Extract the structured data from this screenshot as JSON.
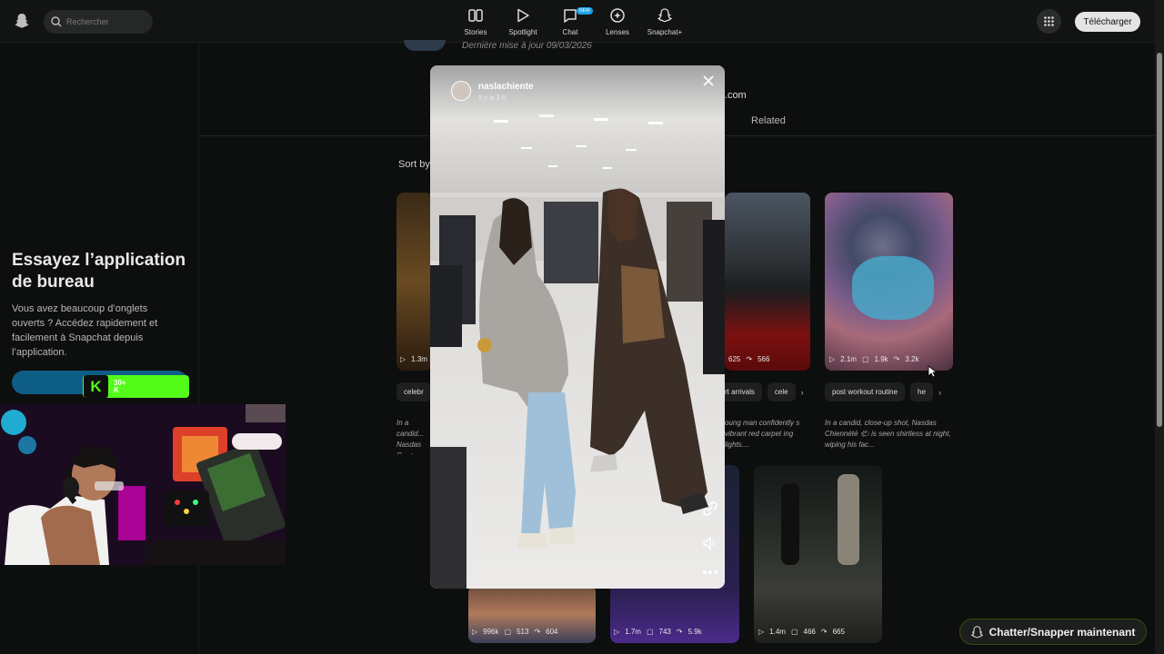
{
  "topbar": {
    "search_placeholder": "Rechercher",
    "nav": [
      {
        "label": "Stories",
        "icon": "stories-icon"
      },
      {
        "label": "Spotlight",
        "icon": "play-icon"
      },
      {
        "label": "Chat",
        "icon": "chat-icon",
        "badge": "NEW"
      },
      {
        "label": "Lenses",
        "icon": "lenses-icon"
      },
      {
        "label": "Snapchat+",
        "icon": "snapchat-plus-icon"
      }
    ],
    "download_label": "Télécharger"
  },
  "sidebar": {
    "promo_title": "Essayez l’application de bureau",
    "promo_text": "Vous avez beaucoup d’onglets ouverts ? Accédez rapidement et facilement à Snapchat depuis l’application."
  },
  "profile": {
    "updated": "Dernière mise à jour 09/03/2026",
    "email_fragment": "il.com",
    "tab_related": "Related",
    "sort_by": "Sort by"
  },
  "cards": [
    {
      "stats": [
        "1.3m"
      ],
      "chips": [
        "celebr"
      ],
      "desc": "In a candid... Nasdas C... a victory s..."
    },
    {
      "stats": [
        "625",
        "566"
      ],
      "chips": [
        "rt arrivals",
        "cele"
      ],
      "desc": "oung man confidently s vibrant red carpet ing lights...."
    },
    {
      "stats": [
        "2.1m",
        "1.9k",
        "3.2k"
      ],
      "chips": [
        "post workout routine",
        "he"
      ],
      "desc": "In a candid, close-up shot, Nasdas Chiennété 🌤 is seen shirtless at night, wiping his fac..."
    }
  ],
  "bottom_cards": [
    {
      "stats": [
        "996k",
        "513",
        "604"
      ]
    },
    {
      "stats": [
        "1.7m",
        "743",
        "5.9k"
      ]
    },
    {
      "stats": [
        "1.4m",
        "466",
        "665"
      ]
    }
  ],
  "modal": {
    "username": "naslachiente",
    "time": "Il y a 3 h"
  },
  "overlay": {
    "kick_text": "30+ K"
  },
  "chat_button": "Chatter/Snapper maintenant"
}
